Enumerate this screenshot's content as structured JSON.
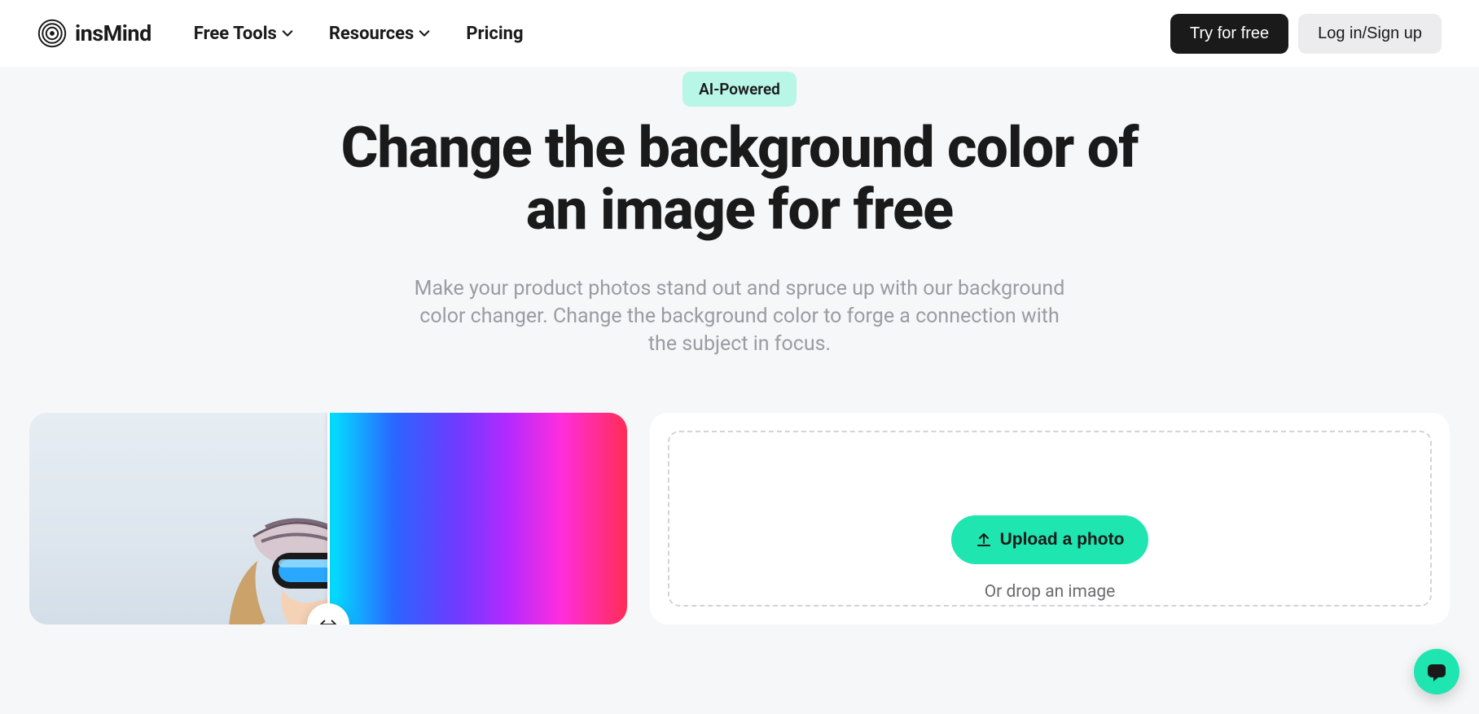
{
  "brand": {
    "name": "insMind"
  },
  "nav": {
    "free_tools": "Free Tools",
    "resources": "Resources",
    "pricing": "Pricing"
  },
  "header": {
    "try_free": "Try for free",
    "login_signup": "Log in/Sign up"
  },
  "hero": {
    "badge": "AI-Powered",
    "title": "Change the background color of an image for free",
    "subtitle": "Make your product photos stand out and spruce up with our background color changer. Change the background color to forge a connection with the subject in focus."
  },
  "upload": {
    "button": "Upload a photo",
    "hint": "Or drop an image"
  },
  "colors": {
    "accent": "#1FE5B0",
    "badge_bg": "#b8f6e7",
    "text_muted": "#9b9ba3"
  }
}
